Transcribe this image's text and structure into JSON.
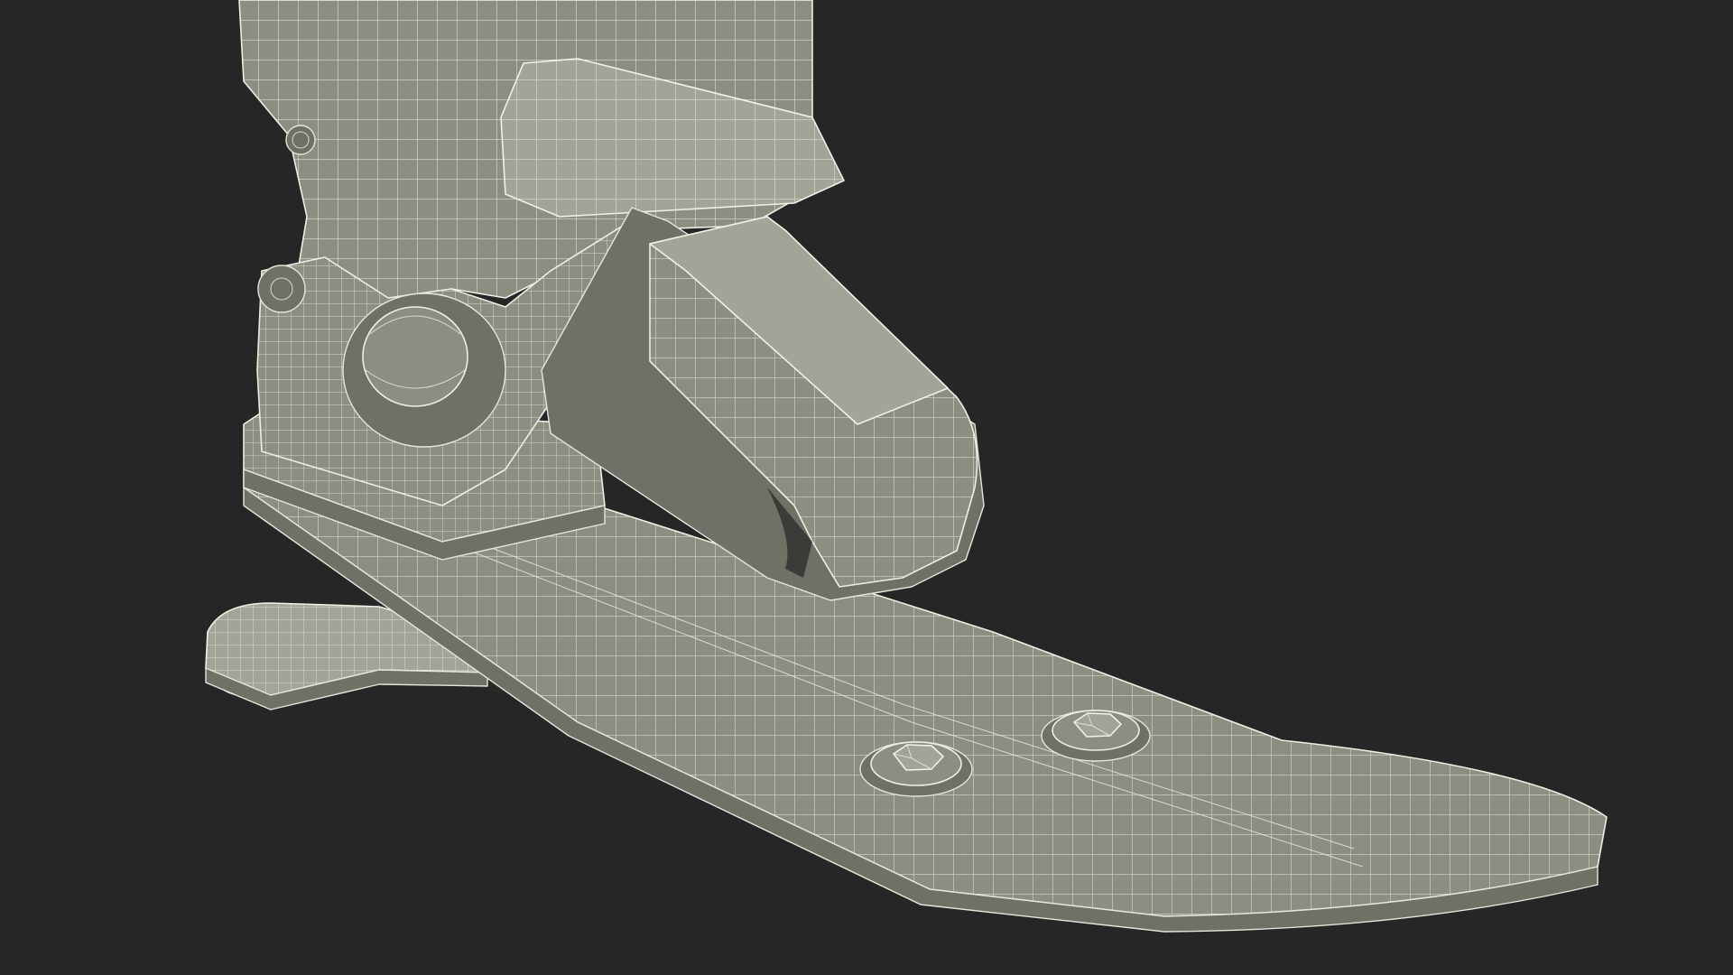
{
  "scene": {
    "background_color": "#262626",
    "model_fill_color": "#8d8e82",
    "wire_color": "#efeee4",
    "parts": [
      "ankle-shell",
      "ankle-joint",
      "heel-lever",
      "connector-block",
      "foot-plate",
      "heel-spring",
      "hex-bolt",
      "hex-bolt"
    ]
  }
}
